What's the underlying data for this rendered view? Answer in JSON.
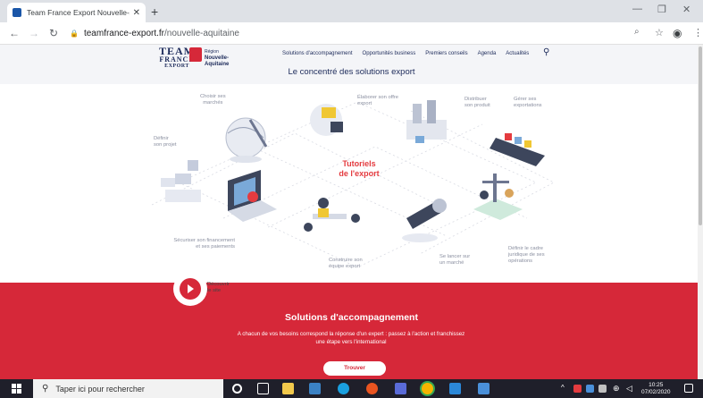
{
  "browser": {
    "tab_title": "Team France Export Nouvelle-A",
    "url_host": "teamfrance-export.fr",
    "url_path": "/nouvelle-aquitaine"
  },
  "header": {
    "logo_line1": "TEAM",
    "logo_line2": "FRANCE",
    "logo_line3": "EXPORT",
    "region_line1": "Région",
    "region_line2": "Nouvelle-",
    "region_line3": "Aquitaine",
    "nav": [
      "Solutions d'accompagnement",
      "Opportunités business",
      "Premiers conseils",
      "Agenda",
      "Actualités"
    ],
    "tagline": "Le concentré des solutions export"
  },
  "illustration": {
    "center_line1": "Tutoriels",
    "center_line2": "de l'export",
    "steps": {
      "definir": [
        "Définir",
        "son projet"
      ],
      "choisir": [
        "Choisir ses",
        "marchés"
      ],
      "elaborer": [
        "Élaborer son offre",
        "export"
      ],
      "distribuer": [
        "Distribuer",
        "son produit"
      ],
      "gerer": [
        "Gérer ses",
        "exportations"
      ],
      "securiser": [
        "Sécuriser son financement",
        "et ses paiements"
      ],
      "construire": [
        "Construire son",
        "équipe export"
      ],
      "lancer": [
        "Se lancer sur",
        "un marché"
      ],
      "cadre": [
        "Définir le cadre",
        "juridique de ses",
        "opérations"
      ]
    }
  },
  "discover": {
    "line1": "Découvrir",
    "line2": "le site"
  },
  "solutions": {
    "title": "Solutions d'accompagnement",
    "desc_line1": "A chacun de vos besoins correspond la réponse d'un expert : passez à l'action et franchissez",
    "desc_line2": "une étape vers l'international",
    "button": "Trouver"
  },
  "taskbar": {
    "search_placeholder": "Taper ici pour rechercher",
    "time": "10:25",
    "date": "07/02/2020"
  },
  "colors": {
    "brand_red": "#d62839",
    "brand_navy": "#1c2a5a",
    "title_red": "#e43b3f"
  }
}
